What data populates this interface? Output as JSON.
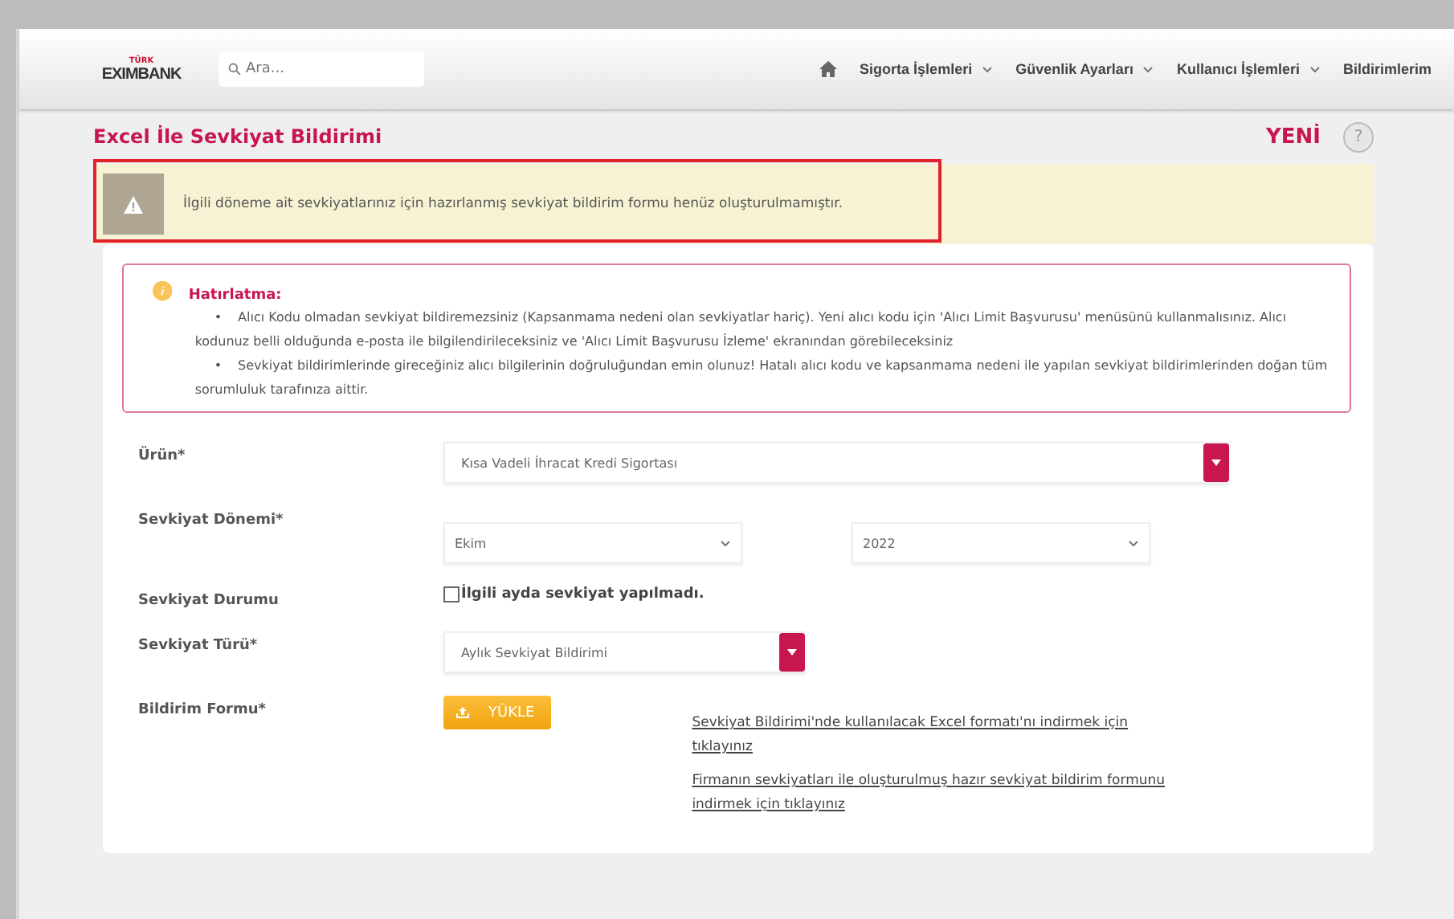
{
  "header": {
    "logo_small": "TÜRK",
    "logo": "EXIMBANK",
    "search": {
      "placeholder": "Ara..."
    },
    "nav": [
      "Sigorta İşlemleri",
      "Güvenlik Ayarları",
      "Kullanıcı İşlemleri",
      "Bildirimlerim"
    ]
  },
  "page": {
    "title": "Excel İle Sevkiyat Bildirimi",
    "badge": "YENİ",
    "help": "?"
  },
  "alert": {
    "text": "İlgili döneme ait sevkiyatlarınız için hazırlanmış sevkiyat bildirim formu henüz oluşturulmamıştır.",
    "highlighted": true
  },
  "reminder": {
    "title": "Hatırlatma:",
    "items": [
      {
        "bullet": "•",
        "text": "Alıcı Kodu olmadan sevkiyat bildiremezsiniz (Kapsanmama nedeni olan sevkiyatlar hariç). Yeni alıcı kodu için 'Alıcı Limit Başvurusu' menüsünü kullanmalısınız. Alıcı kodunuz belli olduğunda e-posta ile bilgilendirileceksiniz ve 'Alıcı Limit Başvurusu İzleme' ekranından görebileceksiniz"
      },
      {
        "bullet": "•",
        "text": "Sevkiyat bildirimlerinde gireceğiniz alıcı bilgilerinin doğruluğundan emin olunuz! Hatalı alıcı kodu ve kapsanmama nedeni ile yapılan sevkiyat bildirimlerinden doğan tüm sorumluluk tarafınıza aittir."
      }
    ]
  },
  "form": [
    {
      "kind": "select",
      "label": "Ürün*",
      "value": "Kısa Vadeli İhracat Kredi Sigortası",
      "wide": true
    },
    {
      "kind": "period",
      "label": "Sevkiyat Dönemi*",
      "month": "Ekim",
      "year": "2022"
    },
    {
      "kind": "checkbox",
      "label": "Sevkiyat Durumu",
      "text": "İlgili ayda sevkiyat yapılmadı.",
      "checked": false
    },
    {
      "kind": "select",
      "label": "Sevkiyat Türü*",
      "value": "Aylık Sevkiyat Bildirimi",
      "wide": false
    },
    {
      "kind": "upload",
      "label": "Bildirim Formu*",
      "button": "YÜKLE",
      "links": [
        "Sevkiyat Bildirimi'nde kullanılacak Excel formatı'nı indirmek için tıklayınız",
        "Firmanın sevkiyatları ile oluşturulmuş hazır sevkiyat bildirim formunu indirmek için tıklayınız"
      ]
    }
  ]
}
